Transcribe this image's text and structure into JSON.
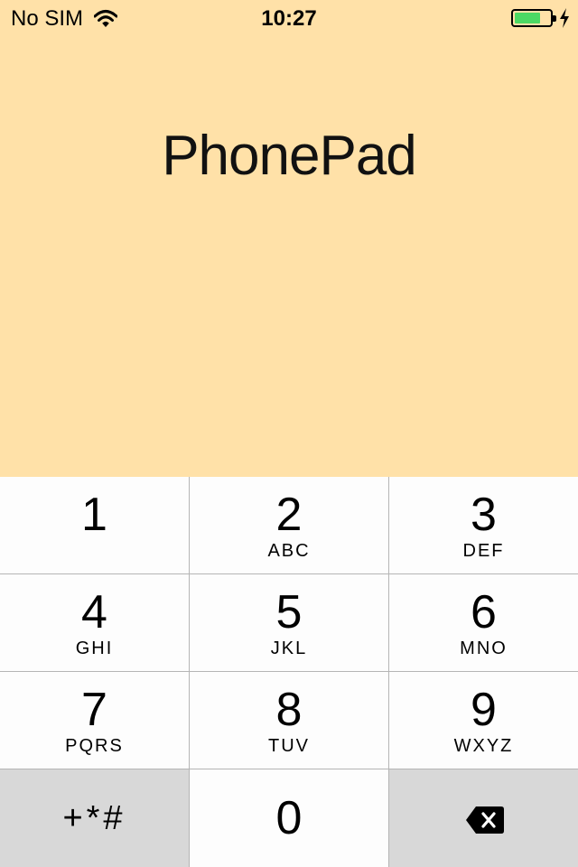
{
  "status_bar": {
    "carrier": "No SIM",
    "time": "10:27",
    "battery_level": 0.75,
    "battery_color": "#4cd964",
    "icons": [
      "wifi-icon",
      "battery-icon",
      "charging-bolt-icon"
    ]
  },
  "app": {
    "title": "PhonePad",
    "background_color": "#ffe1a8"
  },
  "keypad": {
    "keys": [
      {
        "digit": "1",
        "letters": ""
      },
      {
        "digit": "2",
        "letters": "ABC"
      },
      {
        "digit": "3",
        "letters": "DEF"
      },
      {
        "digit": "4",
        "letters": "GHI"
      },
      {
        "digit": "5",
        "letters": "JKL"
      },
      {
        "digit": "6",
        "letters": "MNO"
      },
      {
        "digit": "7",
        "letters": "PQRS"
      },
      {
        "digit": "8",
        "letters": "TUV"
      },
      {
        "digit": "9",
        "letters": "WXYZ"
      }
    ],
    "symbols_key": "+*#",
    "zero_key": "0",
    "backspace_icon": "backspace-icon"
  }
}
